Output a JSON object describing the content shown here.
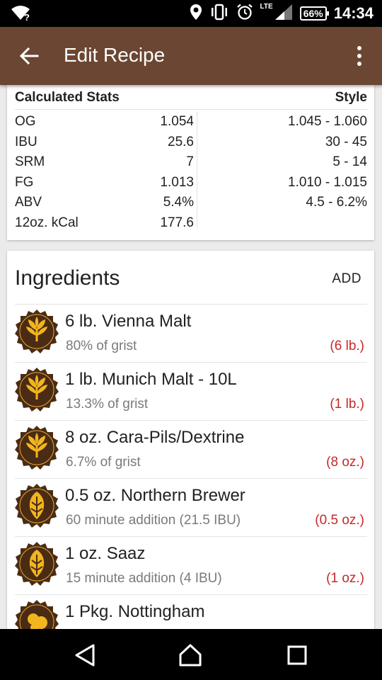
{
  "status_bar": {
    "network_label": "LTE",
    "battery": "66%",
    "time": "14:34",
    "wifi_badge": "?"
  },
  "app_bar": {
    "title": "Edit Recipe",
    "back_icon": "arrow-back-icon",
    "menu_icon": "more-vert-icon",
    "color": "#6b4632"
  },
  "stats": {
    "header_left": "Calculated Stats",
    "header_right": "Style",
    "rows": [
      {
        "label": "OG",
        "value": "1.054",
        "style": "1.045 - 1.060"
      },
      {
        "label": "IBU",
        "value": "25.6",
        "style": "30 - 45"
      },
      {
        "label": "SRM",
        "value": "7",
        "style": "5 - 14"
      },
      {
        "label": "FG",
        "value": "1.013",
        "style": "1.010 - 1.015"
      },
      {
        "label": "ABV",
        "value": "5.4%",
        "style": "4.5 - 6.2%"
      },
      {
        "label": "12oz. kCal",
        "value": "177.6",
        "style": ""
      }
    ]
  },
  "ingredients": {
    "title": "Ingredients",
    "add_label": "ADD",
    "amount_color": "#c62828",
    "items": [
      {
        "name": "6 lb. Vienna Malt",
        "desc": "80% of grist",
        "amount": "(6 lb.)",
        "icon": "grain-icon"
      },
      {
        "name": "1 lb. Munich Malt - 10L",
        "desc": "13.3% of grist",
        "amount": "(1 lb.)",
        "icon": "grain-icon"
      },
      {
        "name": "8 oz. Cara-Pils/Dextrine",
        "desc": "6.7% of grist",
        "amount": "(8 oz.)",
        "icon": "grain-icon"
      },
      {
        "name": "0.5 oz. Northern Brewer",
        "desc": "60 minute addition (21.5 IBU)",
        "amount": "(0.5 oz.)",
        "icon": "hop-icon"
      },
      {
        "name": "1 oz. Saaz",
        "desc": "15 minute addition (4 IBU)",
        "amount": "(1 oz.)",
        "icon": "hop-icon"
      },
      {
        "name": "1 Pkg. Nottingham",
        "desc": "",
        "amount": "",
        "icon": "yeast-icon"
      }
    ]
  },
  "nav_bar": {
    "back": "nav-back-icon",
    "home": "nav-home-icon",
    "recents": "nav-recents-icon"
  }
}
